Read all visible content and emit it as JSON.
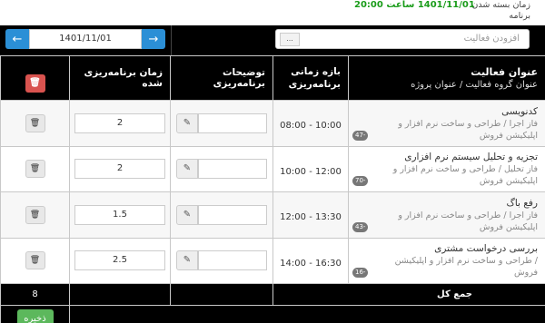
{
  "header": {
    "close_label": "زمان بسته شدن برنامه",
    "close_value": "1401/11/01 ساعت 20:00"
  },
  "toolbar": {
    "prev_icon": "arrow-left-icon",
    "next_icon": "arrow-right-icon",
    "date_value": "1401/11/01",
    "activity_placeholder": "افزودن فعالیت",
    "activity_browse": "..."
  },
  "table": {
    "headers": {
      "title_main": "عنوان فعالیت",
      "title_sub": "عنوان گروه فعالیت  /  عنوان پروژه",
      "range": "بازه زمانی برنامه‌ریزی",
      "desc": "توضیحات برنامه‌ریزی",
      "time": "زمان برنامه‌ریزی شده"
    },
    "rows": [
      {
        "name": "کدنویسی",
        "group": "فاز اجرا",
        "project": "طراحی و ساخت نرم افزار و اپلیکیشن فروش",
        "badge": "-47",
        "start": "08:00",
        "end": "10:00",
        "desc": "",
        "time": "2"
      },
      {
        "name": "تجزیه و تحلیل سیستم نرم افزاری",
        "group": "فاز تحلیل",
        "project": "طراحی و ساخت نرم افزار و اپلیکیشن فروش",
        "badge": "-70",
        "start": "10:00",
        "end": "12:00",
        "desc": "",
        "time": "2"
      },
      {
        "name": "رفع باگ",
        "group": "فاز اجرا",
        "project": "طراحی و ساخت نرم افزار و اپلیکیشن فروش",
        "badge": "-43",
        "start": "12:00",
        "end": "13:30",
        "desc": "",
        "time": "1.5"
      },
      {
        "name": "بررسی درخواست مشتری",
        "group": "",
        "project": "طراحی و ساخت نرم افزار و اپلیکیشن فروش",
        "badge": "-16",
        "start": "14:00",
        "end": "16:30",
        "desc": "",
        "time": "2.5"
      }
    ],
    "footer": {
      "total_label": "جمع کل",
      "total_value": "8",
      "save_label": "ذخیره"
    }
  },
  "colors": {
    "accent": "#2b8fd6",
    "danger": "#d9534f",
    "success": "#5cb85c",
    "close_value": "#1a9c1a"
  }
}
